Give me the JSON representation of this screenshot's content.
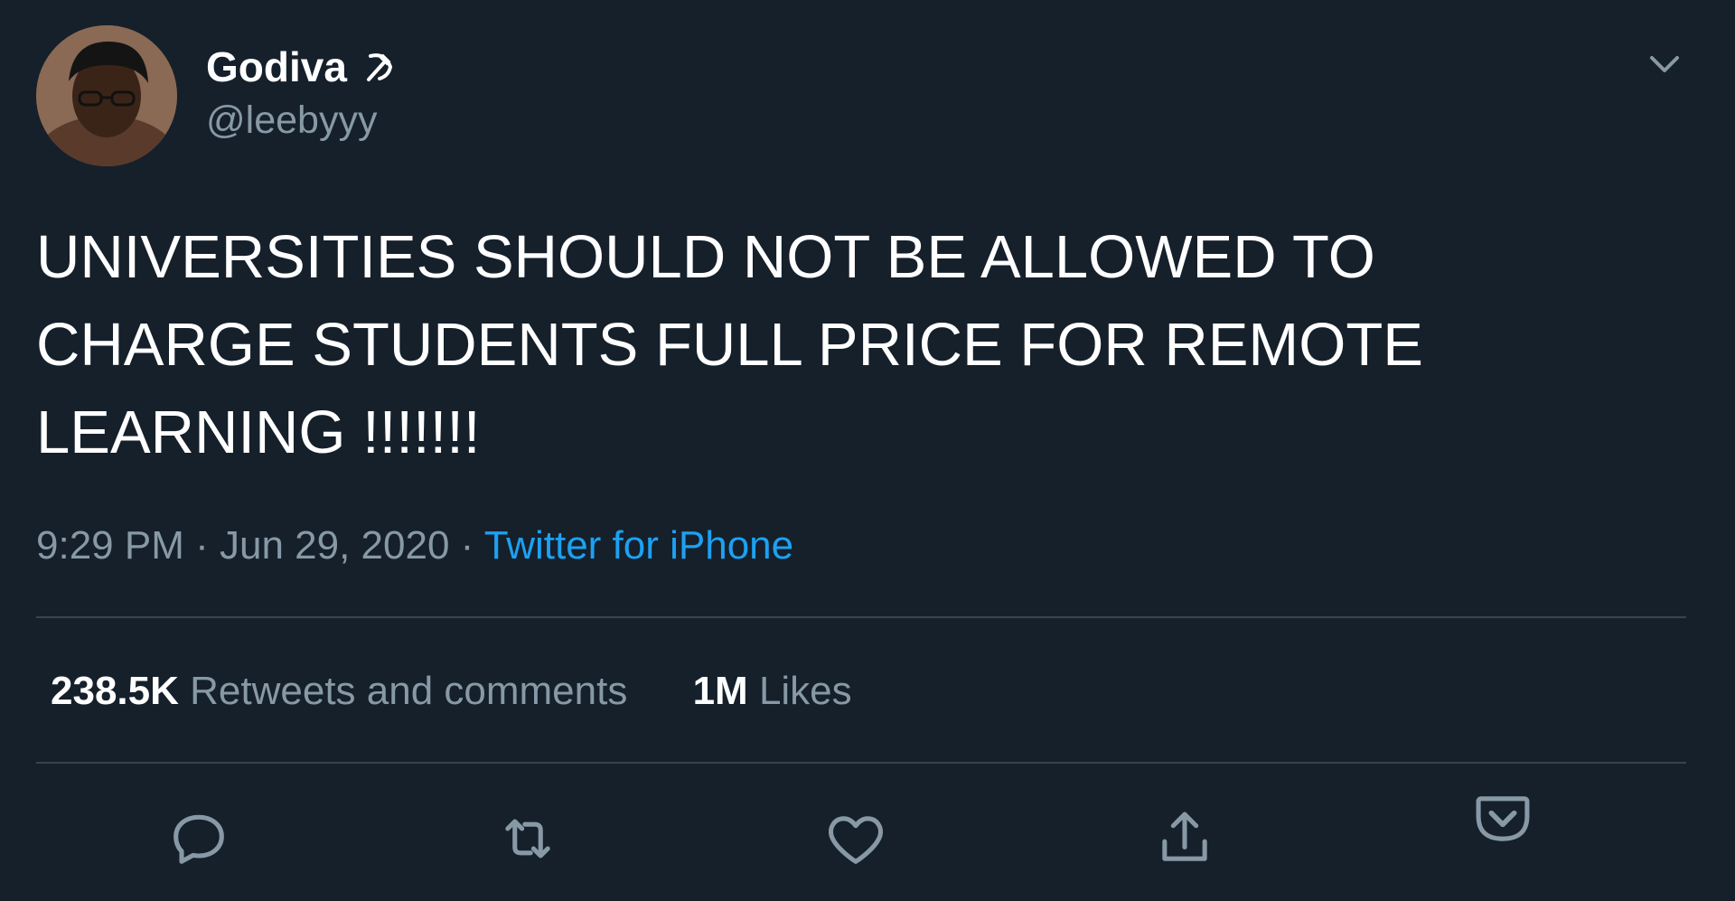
{
  "user": {
    "display_name": "Godiva",
    "name_emoji": "hammer-and-sickle-icon",
    "handle": "@leebyyy"
  },
  "tweet": {
    "text": "UNIVERSITIES SHOULD NOT BE ALLOWED TO CHARGE STUDENTS FULL PRICE FOR REMOTE LEARNING !!!!!!!"
  },
  "meta": {
    "time": "9:29 PM",
    "sep1": " · ",
    "date": "Jun 29, 2020",
    "sep2": " · ",
    "source": "Twitter for iPhone"
  },
  "stats": {
    "retweets_count": "238.5K",
    "retweets_label": "Retweets and comments",
    "likes_count": "1M",
    "likes_label": "Likes"
  },
  "actions": [
    "reply-icon",
    "retweet-icon",
    "like-icon",
    "share-icon",
    "pocket-icon"
  ],
  "colors": {
    "background": "#15202b",
    "text_primary": "#ffffff",
    "text_secondary": "#8899a6",
    "accent": "#1da1f2",
    "divider": "#38444d"
  }
}
